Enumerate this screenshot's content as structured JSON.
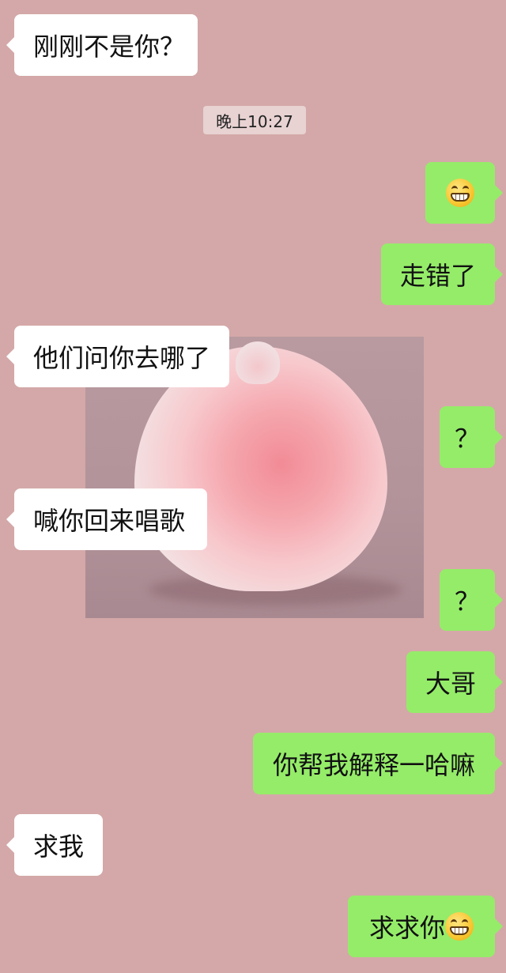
{
  "background_color": "#d4a8a8",
  "colors": {
    "incoming_bubble": "#ffffff",
    "outgoing_bubble": "#95ec69",
    "timestamp_pill": "#e8d2d2"
  },
  "timestamp": "晚上10:27",
  "messages": [
    {
      "side": "incoming",
      "text": "刚刚不是你？"
    },
    {
      "side": "outgoing",
      "text": "",
      "emoji": "grinning-face-emoji"
    },
    {
      "side": "outgoing",
      "text": "走错了"
    },
    {
      "side": "incoming",
      "text": "他们问你去哪了"
    },
    {
      "side": "outgoing",
      "text": "？"
    },
    {
      "side": "incoming",
      "text": "喊你回来唱歌"
    },
    {
      "side": "outgoing",
      "text": "？"
    },
    {
      "side": "outgoing",
      "text": "大哥"
    },
    {
      "side": "outgoing",
      "text": "你帮我解释一哈嘛"
    },
    {
      "side": "incoming",
      "text": "求我"
    },
    {
      "side": "outgoing",
      "text": "求求你",
      "emoji": "grinning-face-emoji"
    }
  ],
  "overlay_image": {
    "name": "peach-bun-photo"
  }
}
